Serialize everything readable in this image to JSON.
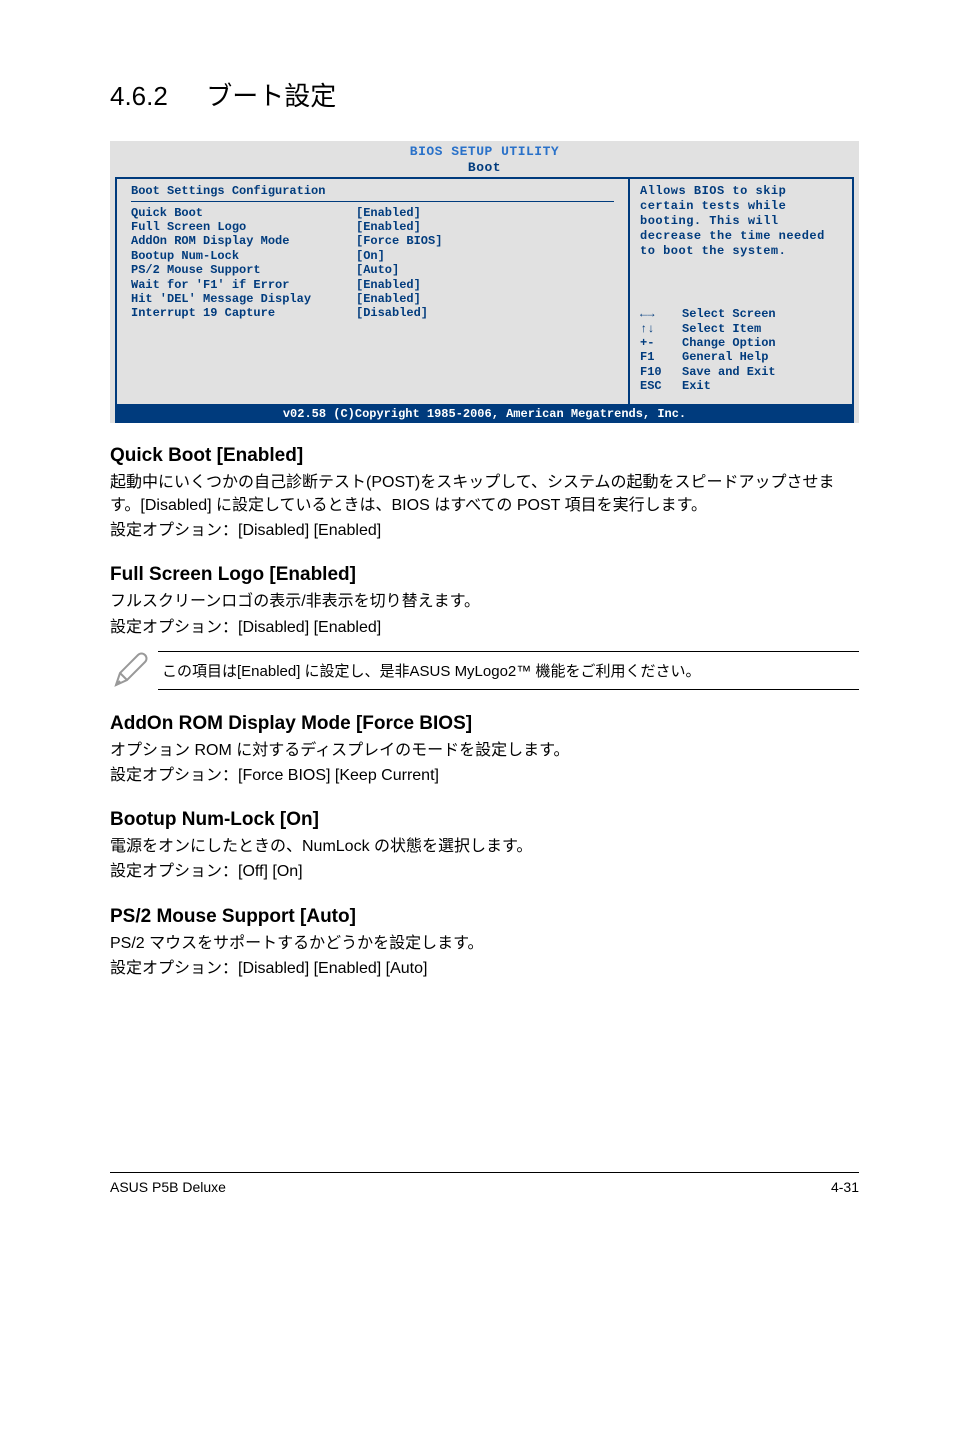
{
  "heading": {
    "num": "4.6.2",
    "title": "ブート設定"
  },
  "bios": {
    "banner": "BIOS SETUP UTILITY",
    "tab": "Boot",
    "section": "Boot Settings Configuration",
    "rows": [
      {
        "k": "Quick Boot",
        "v": "[Enabled]"
      },
      {
        "k": "Full Screen Logo",
        "v": "[Enabled]"
      },
      {
        "k": "AddOn ROM Display Mode",
        "v": "[Force BIOS]"
      },
      {
        "k": "Bootup Num-Lock",
        "v": "[On]"
      },
      {
        "k": "PS/2 Mouse Support",
        "v": "[Auto]"
      },
      {
        "k": "Wait for 'F1' if Error",
        "v": "[Enabled]"
      },
      {
        "k": "Hit 'DEL' Message Display",
        "v": "[Enabled]"
      },
      {
        "k": "Interrupt 19 Capture",
        "v": "[Disabled]"
      }
    ],
    "help": [
      "Allows BIOS to skip",
      "certain tests while",
      "booting. This will",
      "decrease the time needed",
      "to boot the system."
    ],
    "nav": [
      {
        "k": "←→",
        "v": "Select Screen"
      },
      {
        "k": "↑↓",
        "v": "Select Item"
      },
      {
        "k": "+-",
        "v": "Change Option"
      },
      {
        "k": "F1",
        "v": "General Help"
      },
      {
        "k": "F10",
        "v": "Save and Exit"
      },
      {
        "k": "ESC",
        "v": "Exit"
      }
    ],
    "copyright": "v02.58 (C)Copyright 1985-2006, American Megatrends, Inc."
  },
  "sections": {
    "quickboot": {
      "h": "Quick Boot [Enabled]",
      "p1": "起動中にいくつかの自己診断テスト(POST)をスキップして、システムの起動をスピードアップさせます。[Disabled] に設定しているときは、BIOS はすべての POST 項目を実行します。",
      "p2": "設定オプション：[Disabled] [Enabled]"
    },
    "fullscreen": {
      "h": "Full Screen Logo [Enabled]",
      "p1": "フルスクリーンロゴの表示/非表示を切り替えます。",
      "p2": "設定オプション：[Disabled] [Enabled]"
    },
    "note": "この項目は[Enabled] に設定し、是非ASUS MyLogo2™ 機能をご利用ください。",
    "addon": {
      "h": "AddOn ROM Display Mode [Force BIOS]",
      "p1": "オプション ROM に対するディスプレイのモードを設定します。",
      "p2": "設定オプション：[Force BIOS] [Keep Current]"
    },
    "numlock": {
      "h": "Bootup Num-Lock [On]",
      "p1": "電源をオンにしたときの、NumLock の状態を選択します。",
      "p2": "設定オプション：[Off] [On]"
    },
    "ps2": {
      "h": "PS/2 Mouse Support [Auto]",
      "p1": "PS/2 マウスをサポートするかどうかを設定します。",
      "p2": "設定オプション：[Disabled] [Enabled] [Auto]"
    }
  },
  "footer": {
    "left": "ASUS P5B Deluxe",
    "right": "4-31"
  }
}
